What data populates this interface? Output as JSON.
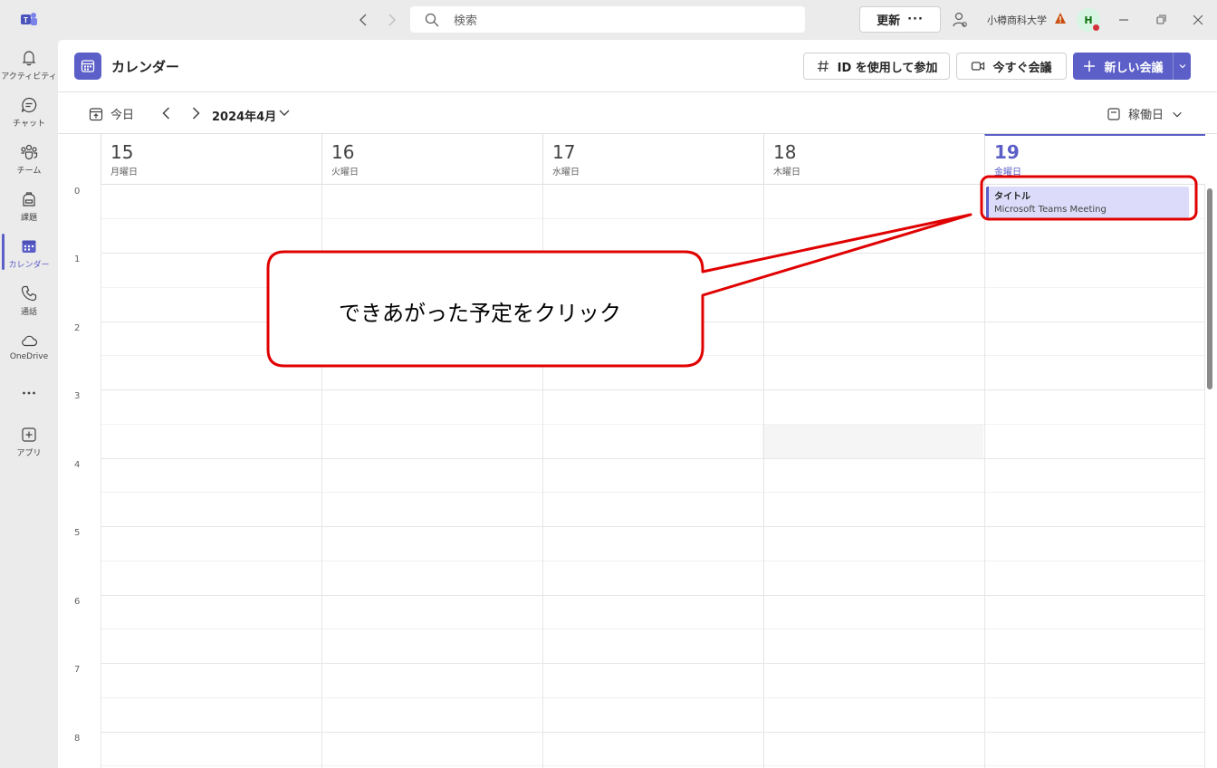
{
  "titlebar": {
    "search_placeholder": "検索",
    "update_label": "更新",
    "update_more": "···",
    "org_name": "小樽商科大学",
    "avatar_initial": "H"
  },
  "rail": {
    "items": [
      {
        "label": "アクティビティ",
        "icon": "bell-icon"
      },
      {
        "label": "チャット",
        "icon": "chat-icon"
      },
      {
        "label": "チーム",
        "icon": "teams-icon"
      },
      {
        "label": "課題",
        "icon": "backpack-icon"
      },
      {
        "label": "カレンダー",
        "icon": "calendar-icon",
        "active": true
      },
      {
        "label": "通話",
        "icon": "phone-icon"
      },
      {
        "label": "OneDrive",
        "icon": "cloud-icon"
      },
      {
        "label": "アプリ",
        "icon": "add-app-icon"
      }
    ]
  },
  "header": {
    "title": "カレンダー",
    "join_with_id": "ID を使用して参加",
    "meet_now": "今すぐ会議",
    "new_meeting": "新しい会議"
  },
  "toolbar": {
    "today": "今日",
    "month": "2024年4月",
    "view": "稼働日"
  },
  "days": [
    {
      "num": "15",
      "weekday": "月曜日"
    },
    {
      "num": "16",
      "weekday": "火曜日"
    },
    {
      "num": "17",
      "weekday": "水曜日"
    },
    {
      "num": "18",
      "weekday": "木曜日"
    },
    {
      "num": "19",
      "weekday": "金曜日",
      "today": true
    }
  ],
  "hours": [
    "0",
    "1",
    "2",
    "3",
    "4",
    "5",
    "6",
    "7",
    "8"
  ],
  "event": {
    "title": "タイトル",
    "subtitle": "Microsoft Teams Meeting"
  },
  "annotation": {
    "text": "できあがった予定をクリック",
    "color": "#e00000"
  },
  "colors": {
    "accent": "#5b5fc7",
    "event_bg": "#dcdcfa"
  }
}
